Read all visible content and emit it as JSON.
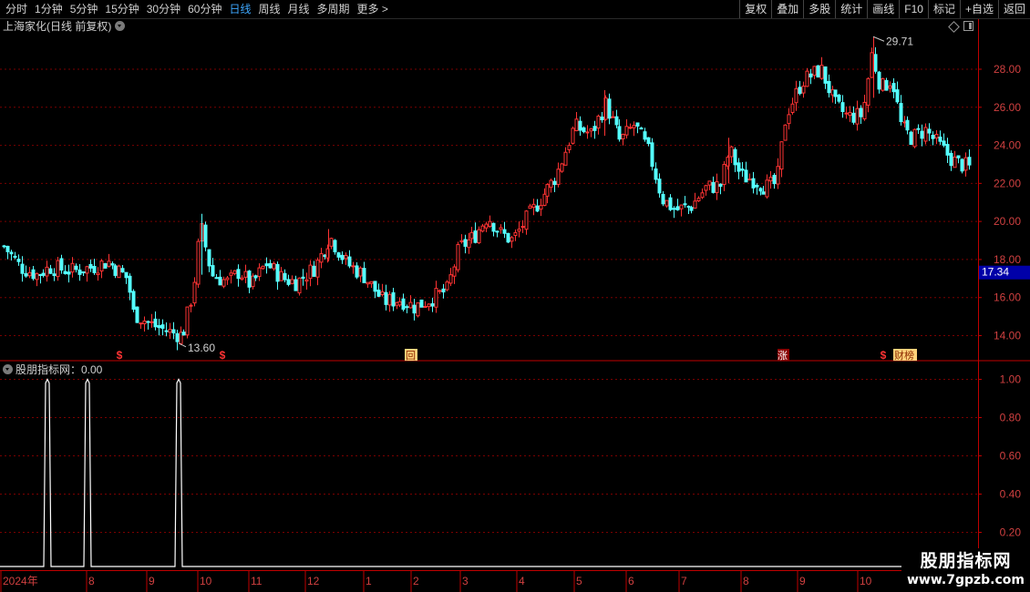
{
  "toolbar": {
    "periods": [
      {
        "label": "分时",
        "active": false
      },
      {
        "label": "1分钟",
        "active": false
      },
      {
        "label": "5分钟",
        "active": false
      },
      {
        "label": "15分钟",
        "active": false
      },
      {
        "label": "30分钟",
        "active": false
      },
      {
        "label": "60分钟",
        "active": false
      },
      {
        "label": "日线",
        "active": true
      },
      {
        "label": "周线",
        "active": false
      },
      {
        "label": "月线",
        "active": false
      },
      {
        "label": "多周期",
        "active": false
      },
      {
        "label": "更多 >",
        "active": false
      }
    ],
    "actions": [
      "复权",
      "叠加",
      "多股",
      "统计",
      "画线",
      "F10",
      "标记",
      "+自选",
      "返回"
    ]
  },
  "main_chart": {
    "title": "上海家化(日线 前复权)",
    "y_ticks": [
      "28.00",
      "26.00",
      "24.00",
      "22.00",
      "20.00",
      "18.00",
      "16.00",
      "14.00"
    ],
    "current_price": "17.34",
    "high_label": "29.71",
    "low_label": "13.60",
    "markers": [
      {
        "text": "$",
        "type": "dollar"
      },
      {
        "text": "$",
        "type": "dollar"
      },
      {
        "text": "回",
        "type": "box"
      },
      {
        "text": "涨",
        "type": "red"
      },
      {
        "text": "$",
        "type": "dollar"
      },
      {
        "text": "财榜",
        "type": "box"
      }
    ],
    "colors": {
      "up": "#ff3333",
      "down": "#54ffff",
      "grid": "#7a0000",
      "axis": "#c00000",
      "selected_price_bg": "#0000a8"
    }
  },
  "indicator": {
    "title": "股朋指标网：0.00",
    "y_ticks": [
      "1.00",
      "0.80",
      "0.60",
      "0.40",
      "0.20"
    ]
  },
  "x_axis": {
    "labels": [
      "2024年",
      "8",
      "9",
      "10",
      "11",
      "12",
      "1",
      "2",
      "3",
      "4",
      "5",
      "6",
      "7",
      "8",
      "9",
      "10"
    ]
  },
  "watermark": {
    "name": "股朋指标网",
    "url": "www.7gpzb.com"
  },
  "chart_data": {
    "type": "candlestick",
    "title": "上海家化(日线 前复权)",
    "ylim": [
      13.0,
      30.0
    ],
    "price_path": [
      {
        "x": "2024-06",
        "y": 18.6
      },
      {
        "x": "2024-07",
        "y": 17.5
      },
      {
        "x": "2024-07",
        "y": 17.6
      },
      {
        "x": "2024-08",
        "y": 17.8
      },
      {
        "x": "2024-08",
        "y": 14.4
      },
      {
        "x": "2024-09",
        "y": 13.8
      },
      {
        "x": "2024-09",
        "y": 20.3
      },
      {
        "x": "2024-10",
        "y": 16.5
      },
      {
        "x": "2024-11",
        "y": 17.8
      },
      {
        "x": "2024-11",
        "y": 19.4
      },
      {
        "x": "2024-12",
        "y": 16.2
      },
      {
        "x": "2025-01",
        "y": 15.6
      },
      {
        "x": "2025-02",
        "y": 16.0
      },
      {
        "x": "2025-03",
        "y": 20.3
      },
      {
        "x": "2025-04",
        "y": 19.2
      },
      {
        "x": "2025-04",
        "y": 21.5
      },
      {
        "x": "2025-05",
        "y": 26.6
      },
      {
        "x": "2025-06",
        "y": 24.5
      },
      {
        "x": "2025-07",
        "y": 20.5
      },
      {
        "x": "2025-08",
        "y": 22.5
      },
      {
        "x": "2025-08",
        "y": 21.6
      },
      {
        "x": "2025-09",
        "y": 28.4
      },
      {
        "x": "2025-09",
        "y": 25.6
      },
      {
        "x": "2025-10",
        "y": 29.6
      },
      {
        "x": "2025-10",
        "y": 24.6
      },
      {
        "x": "2025-11",
        "y": 22.6
      }
    ],
    "indicator_series": {
      "name": "股朋指标网",
      "values": [
        0,
        1,
        0,
        1,
        0,
        1,
        0
      ],
      "ylim": [
        0,
        1.1
      ]
    }
  }
}
